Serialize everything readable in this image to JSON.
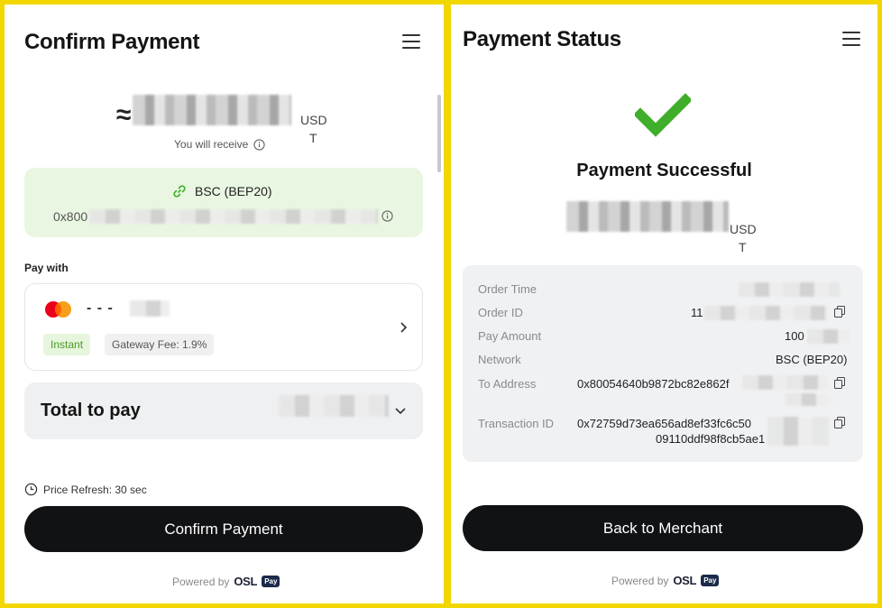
{
  "confirm": {
    "title": "Confirm Payment",
    "approx_symbol": "≈",
    "amount_unit_line1": "USD",
    "amount_unit_line2": "T",
    "receive_label": "You will receive",
    "network_name": "BSC (BEP20)",
    "address_prefix": "0x800",
    "pay_with_label": "Pay with",
    "card_mask": "- - -",
    "tag_instant": "Instant",
    "tag_fee": "Gateway Fee: 1.9%",
    "total_label": "Total to pay",
    "price_refresh": "Price Refresh: 30 sec",
    "confirm_button": "Confirm Payment",
    "powered_by": "Powered by",
    "brand": "OSL",
    "brand_badge": "Pay"
  },
  "status": {
    "title": "Payment Status",
    "success_text": "Payment Successful",
    "amount_unit_line1": "USD",
    "amount_unit_line2": "T",
    "details": [
      {
        "label": "Order Time",
        "value": ""
      },
      {
        "label": "Order ID",
        "value": "11"
      },
      {
        "label": "Pay Amount",
        "value": "100"
      },
      {
        "label": "Network",
        "value": "BSC (BEP20)"
      },
      {
        "label": "To Address",
        "value": "0x80054640b9872bc82e862f"
      },
      {
        "label": "Transaction ID",
        "value_line1": "0x72759d73ea656ad8ef33fc6c50",
        "value_line2": "09110ddf98f8cb5ae1"
      }
    ],
    "back_button": "Back to Merchant",
    "powered_by": "Powered by",
    "brand": "OSL",
    "brand_badge": "Pay"
  },
  "colors": {
    "frame": "#f2d600",
    "success_green": "#3fae2a",
    "network_bg": "#e9f6e1",
    "button_bg": "#111214"
  },
  "icons": [
    "menu-icon",
    "info-icon",
    "link-icon",
    "mastercard-icon",
    "chevron-right-icon",
    "chevron-down-icon",
    "clock-icon",
    "checkmark-icon",
    "copy-icon"
  ]
}
